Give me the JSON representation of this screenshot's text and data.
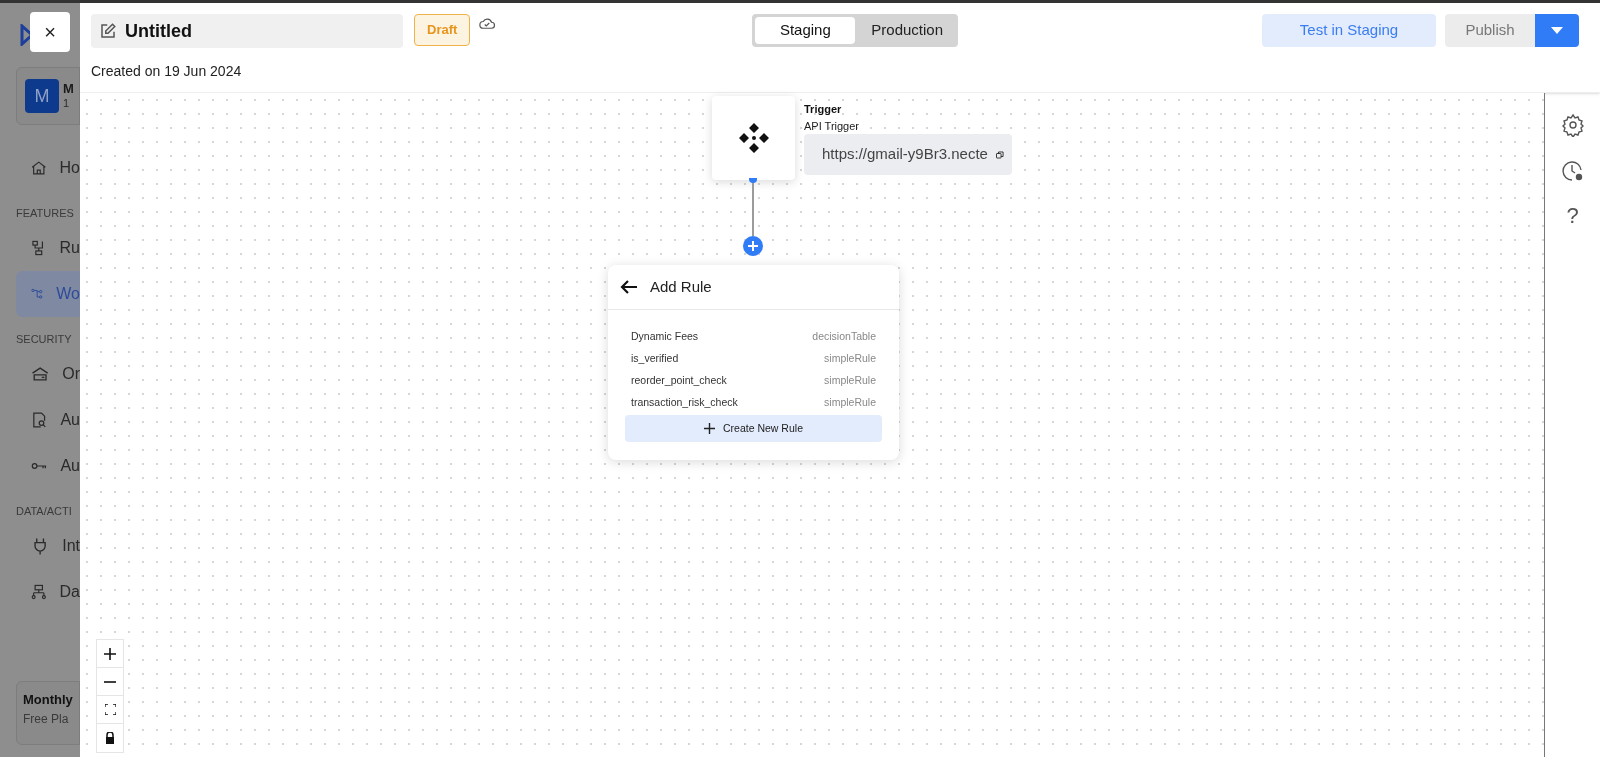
{
  "sidebar": {
    "account": {
      "avatar": "M",
      "name": "M",
      "sub": "1"
    },
    "sections": [
      {
        "kind": "item",
        "label": "Ho",
        "selected": false
      },
      {
        "kind": "heading",
        "label": "FEATURES"
      },
      {
        "kind": "item",
        "label": "Ru",
        "selected": false
      },
      {
        "kind": "item",
        "label": "Wo",
        "selected": true
      },
      {
        "kind": "heading",
        "label": "SECURITY"
      },
      {
        "kind": "item",
        "label": "Or",
        "selected": false
      },
      {
        "kind": "item",
        "label": "Au",
        "selected": false
      },
      {
        "kind": "item",
        "label": "Au",
        "selected": false
      },
      {
        "kind": "heading",
        "label": "DATA/ACTI"
      },
      {
        "kind": "item",
        "label": "Int",
        "selected": false
      },
      {
        "kind": "item",
        "label": "Da",
        "selected": false
      }
    ],
    "plan": {
      "title": "Monthly",
      "sub": "Free Pla"
    }
  },
  "close_button": "×",
  "header": {
    "title": "Untitled",
    "status": "Draft",
    "created": "Created on 19 Jun 2024",
    "environments": [
      {
        "label": "Staging",
        "selected": true
      },
      {
        "label": "Production",
        "selected": false
      }
    ],
    "test_button": "Test in Staging",
    "publish_button": "Publish"
  },
  "trigger": {
    "title": "Trigger",
    "type": "API Trigger",
    "url": "https://gmail-y9Br3.necte"
  },
  "add_rule": {
    "title": "Add Rule",
    "rules": [
      {
        "name": "Dynamic Fees",
        "type": "decisionTable"
      },
      {
        "name": "is_verified",
        "type": "simpleRule"
      },
      {
        "name": "reorder_point_check",
        "type": "simpleRule"
      },
      {
        "name": "transaction_risk_check",
        "type": "simpleRule"
      }
    ],
    "create_button": "Create New Rule"
  },
  "right_toolbar": [
    "?"
  ]
}
